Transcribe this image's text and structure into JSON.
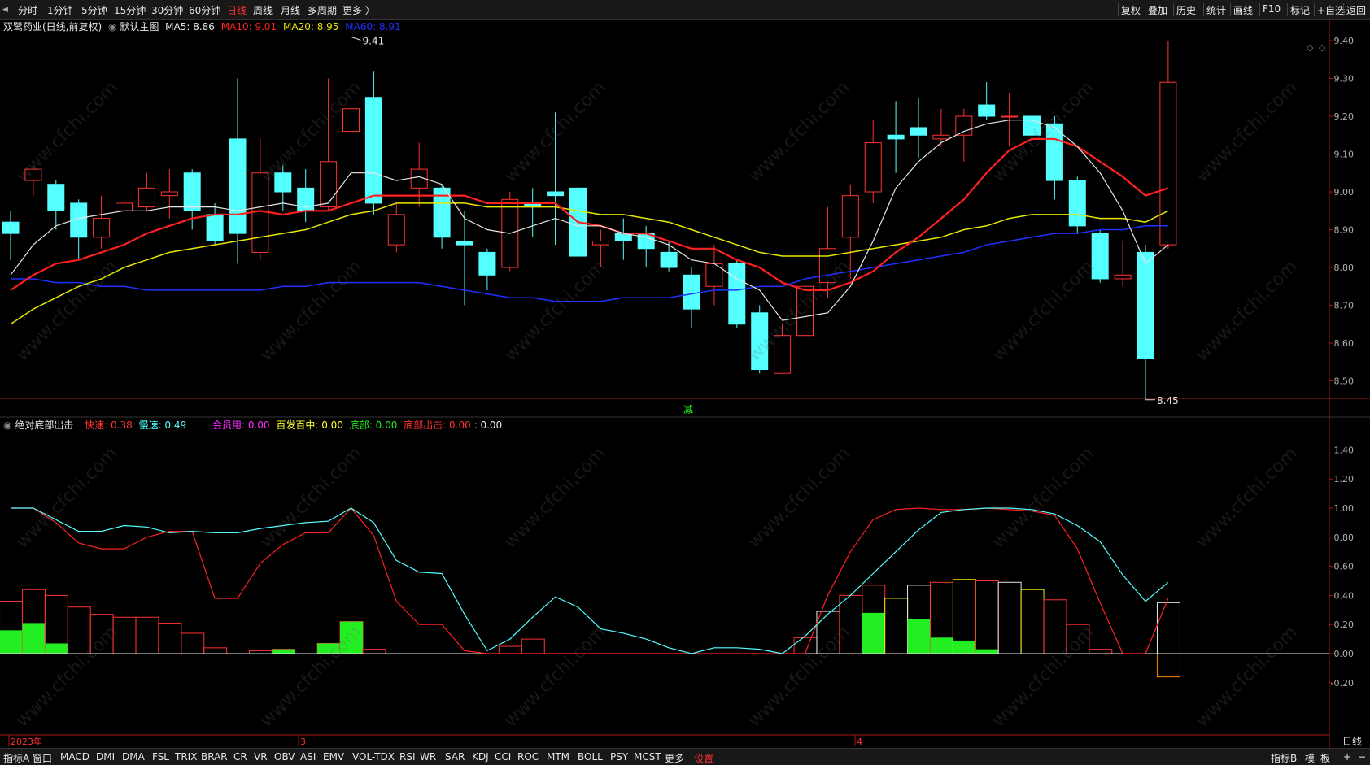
{
  "toolbar": {
    "left_items": [
      "分时",
      "1分钟",
      "5分钟",
      "15分钟",
      "30分钟",
      "60分钟",
      "日线",
      "周线",
      "月线",
      "多周期",
      "更多 〉"
    ],
    "active": "日线",
    "right_items": [
      "复权",
      "叠加",
      "历史",
      "统计",
      "画线",
      "F10",
      "标记",
      "+自选",
      "返回"
    ]
  },
  "main_info": {
    "title": "双鹭药业(日线,前复权)",
    "template_label": "默认主图",
    "ma5": "MA5: 8.86",
    "ma10": "MA10: 9.01",
    "ma20": "MA20: 8.95",
    "ma60": "MA60: 8.91"
  },
  "sub_info": {
    "name": "绝对底部出击",
    "fast": "快速: 0.38",
    "slow": "慢速: 0.49",
    "member": "会员用: 0.00",
    "baifa": "百发百中: 0.00",
    "bottom": "底部: 0.00",
    "bottom_strike": "底部出击: 0.00",
    "extra": ": 0.00"
  },
  "colors": {
    "up": "#ff3232",
    "down": "#54ffff",
    "ma5": "#e6e6e6",
    "ma10": "#ff2020",
    "ma20": "#e6e600",
    "ma60": "#2030ff",
    "grid_axis": "#b01515",
    "green": "#22ee22"
  },
  "date_labels": [
    "2023年",
    "3",
    "4"
  ],
  "marker_label": "减",
  "bottom_tabs": [
    "指标A",
    "窗口",
    "MACD",
    "DMI",
    "DMA",
    "FSL",
    "TRIX",
    "BRAR",
    "CR",
    "VR",
    "OBV",
    "ASI",
    "EMV",
    "VOL-TDX",
    "RSI",
    "WR",
    "SAR",
    "KDJ",
    "CCI",
    "ROC",
    "MTM",
    "BOLL",
    "PSY",
    "MCST",
    "更多",
    "设置"
  ],
  "bottom_right": [
    "指标B",
    "模",
    "板",
    "+",
    "−"
  ],
  "right_panel_label": "日线",
  "watermark": "www.cfchi.com",
  "chart_data": [
    {
      "type": "candlestick",
      "title": "双鹭药业(日线,前复权)",
      "ylim": [
        8.45,
        9.45
      ],
      "y_ticks": [
        9.4,
        9.3,
        9.2,
        9.1,
        9.0,
        8.9,
        8.8,
        8.7,
        8.6,
        8.5
      ],
      "high_label": "9.41",
      "low_label": "8.45",
      "candles": [
        [
          8.92,
          8.89,
          8.95,
          8.82
        ],
        [
          9.03,
          9.06,
          9.07,
          8.99
        ],
        [
          9.02,
          8.95,
          9.03,
          8.9
        ],
        [
          8.97,
          8.88,
          8.98,
          8.82
        ],
        [
          8.88,
          8.93,
          8.99,
          8.85
        ],
        [
          8.95,
          8.97,
          8.98,
          8.83
        ],
        [
          8.96,
          9.01,
          9.05,
          8.95
        ],
        [
          8.99,
          9.0,
          9.06,
          8.93
        ],
        [
          9.05,
          8.95,
          9.06,
          8.9
        ],
        [
          8.94,
          8.87,
          8.97,
          8.86
        ],
        [
          9.14,
          8.89,
          9.3,
          8.81
        ],
        [
          8.84,
          9.05,
          9.14,
          8.82
        ],
        [
          9.05,
          9.0,
          9.07,
          8.95
        ],
        [
          9.01,
          8.95,
          9.06,
          8.92
        ],
        [
          8.96,
          9.08,
          9.3,
          8.95
        ],
        [
          9.16,
          9.22,
          9.41,
          9.15
        ],
        [
          9.25,
          8.97,
          9.32,
          8.94
        ],
        [
          8.86,
          8.94,
          8.97,
          8.84
        ],
        [
          9.01,
          9.06,
          9.13,
          8.96
        ],
        [
          9.01,
          8.88,
          9.02,
          8.85
        ],
        [
          8.87,
          8.86,
          8.95,
          8.7
        ],
        [
          8.84,
          8.78,
          8.85,
          8.74
        ],
        [
          8.8,
          8.98,
          9.0,
          8.79
        ],
        [
          8.97,
          8.96,
          9.01,
          8.88
        ],
        [
          9.0,
          8.99,
          9.21,
          8.86
        ],
        [
          9.01,
          8.83,
          9.03,
          8.79
        ],
        [
          8.86,
          8.87,
          8.9,
          8.8
        ],
        [
          8.89,
          8.87,
          8.93,
          8.82
        ],
        [
          8.89,
          8.85,
          8.91,
          8.8
        ],
        [
          8.84,
          8.8,
          8.87,
          8.79
        ],
        [
          8.78,
          8.69,
          8.8,
          8.64
        ],
        [
          8.75,
          8.81,
          8.86,
          8.7
        ],
        [
          8.81,
          8.65,
          8.82,
          8.64
        ],
        [
          8.68,
          8.53,
          8.7,
          8.52
        ],
        [
          8.52,
          8.62,
          8.65,
          8.52
        ],
        [
          8.62,
          8.75,
          8.8,
          8.59
        ],
        [
          8.76,
          8.85,
          8.96,
          8.72
        ],
        [
          8.88,
          8.99,
          9.02,
          8.77
        ],
        [
          9.0,
          9.13,
          9.19,
          8.97
        ],
        [
          9.15,
          9.14,
          9.24,
          9.05
        ],
        [
          9.17,
          9.15,
          9.25,
          9.09
        ],
        [
          9.14,
          9.15,
          9.22,
          9.12
        ],
        [
          9.15,
          9.2,
          9.22,
          9.08
        ],
        [
          9.23,
          9.2,
          9.29,
          9.19
        ],
        [
          9.2,
          9.2,
          9.26,
          9.12
        ],
        [
          9.2,
          9.15,
          9.21,
          9.1
        ],
        [
          9.18,
          9.03,
          9.2,
          8.98
        ],
        [
          9.03,
          8.91,
          9.04,
          8.89
        ],
        [
          8.89,
          8.77,
          8.9,
          8.76
        ],
        [
          8.77,
          8.78,
          8.87,
          8.75
        ],
        [
          8.84,
          8.56,
          8.86,
          8.45
        ],
        [
          8.86,
          9.29,
          9.4,
          8.85
        ]
      ],
      "ma5": [
        8.78,
        8.86,
        8.91,
        8.93,
        8.94,
        8.95,
        8.95,
        8.96,
        8.96,
        8.96,
        8.95,
        8.96,
        8.97,
        8.96,
        8.97,
        9.05,
        9.05,
        9.03,
        9.04,
        9.02,
        8.93,
        8.9,
        8.89,
        8.91,
        8.93,
        8.91,
        8.91,
        8.89,
        8.88,
        8.86,
        8.82,
        8.81,
        8.77,
        8.74,
        8.66,
        8.67,
        8.68,
        8.75,
        8.87,
        9.01,
        9.08,
        9.13,
        9.16,
        9.18,
        9.19,
        9.19,
        9.17,
        9.12,
        9.05,
        8.95,
        8.81,
        8.86
      ],
      "ma10": [
        8.74,
        8.78,
        8.81,
        8.82,
        8.84,
        8.86,
        8.89,
        8.91,
        8.93,
        8.94,
        8.94,
        8.95,
        8.94,
        8.95,
        8.95,
        8.97,
        8.99,
        8.99,
        8.99,
        8.99,
        8.99,
        8.97,
        8.97,
        8.97,
        8.97,
        8.92,
        8.91,
        8.89,
        8.89,
        8.87,
        8.85,
        8.85,
        8.82,
        8.8,
        8.76,
        8.74,
        8.74,
        8.76,
        8.79,
        8.84,
        8.88,
        8.93,
        8.98,
        9.05,
        9.11,
        9.14,
        9.14,
        9.12,
        9.08,
        9.04,
        8.99,
        9.01
      ],
      "ma20": [
        8.65,
        8.69,
        8.72,
        8.75,
        8.77,
        8.8,
        8.82,
        8.84,
        8.85,
        8.86,
        8.87,
        8.88,
        8.89,
        8.9,
        8.92,
        8.94,
        8.95,
        8.97,
        8.97,
        8.97,
        8.97,
        8.96,
        8.96,
        8.96,
        8.96,
        8.95,
        8.94,
        8.94,
        8.93,
        8.92,
        8.9,
        8.88,
        8.86,
        8.84,
        8.83,
        8.83,
        8.83,
        8.84,
        8.85,
        8.86,
        8.87,
        8.88,
        8.9,
        8.91,
        8.93,
        8.94,
        8.94,
        8.94,
        8.93,
        8.93,
        8.92,
        8.95
      ],
      "ma60": [
        8.77,
        8.77,
        8.76,
        8.76,
        8.75,
        8.75,
        8.74,
        8.74,
        8.74,
        8.74,
        8.74,
        8.74,
        8.75,
        8.75,
        8.76,
        8.76,
        8.76,
        8.76,
        8.76,
        8.75,
        8.74,
        8.73,
        8.72,
        8.72,
        8.71,
        8.71,
        8.71,
        8.72,
        8.72,
        8.72,
        8.73,
        8.74,
        8.74,
        8.75,
        8.75,
        8.77,
        8.78,
        8.79,
        8.8,
        8.81,
        8.82,
        8.83,
        8.84,
        8.86,
        8.87,
        8.88,
        8.89,
        8.89,
        8.9,
        8.9,
        8.91,
        8.91
      ]
    },
    {
      "type": "line",
      "title": "绝对底部出击",
      "ylim": [
        -0.32,
        1.5
      ],
      "y_ticks": [
        1.4,
        1.2,
        1.0,
        0.8,
        0.6,
        0.4,
        0.2,
        0.0,
        -0.2
      ],
      "series": [
        {
          "name": "快速",
          "values": [
            1.0,
            1.0,
            0.9,
            0.76,
            0.72,
            0.72,
            0.8,
            0.84,
            0.84,
            0.38,
            0.38,
            0.62,
            0.75,
            0.83,
            0.83,
            1.0,
            0.81,
            0.36,
            0.2,
            0.2,
            0.02,
            0.0,
            0.0,
            0.0,
            0.0,
            0.0,
            0.0,
            0.0,
            0.0,
            0.0,
            0.0,
            0.0,
            0.0,
            0.0,
            0.0,
            0.0,
            0.4,
            0.7,
            0.92,
            0.99,
            1.0,
            0.99,
            0.99,
            1.0,
            0.99,
            0.98,
            0.95,
            0.72,
            0.35,
            0.0,
            0.0,
            0.38
          ]
        },
        {
          "name": "慢速",
          "values": [
            1.0,
            1.0,
            0.92,
            0.84,
            0.84,
            0.88,
            0.87,
            0.83,
            0.84,
            0.83,
            0.83,
            0.86,
            0.88,
            0.9,
            0.91,
            1.0,
            0.9,
            0.64,
            0.56,
            0.55,
            0.27,
            0.02,
            0.1,
            0.25,
            0.39,
            0.32,
            0.17,
            0.14,
            0.1,
            0.04,
            0.0,
            0.04,
            0.04,
            0.03,
            0.0,
            0.12,
            0.27,
            0.4,
            0.55,
            0.7,
            0.85,
            0.97,
            0.99,
            1.0,
            1.0,
            0.99,
            0.96,
            0.88,
            0.77,
            0.54,
            0.36,
            0.49
          ]
        }
      ],
      "bars": [
        [
          0.36,
          0.16
        ],
        [
          0.44,
          0.21
        ],
        [
          0.4,
          0.07
        ],
        [
          0.32,
          0.0
        ],
        [
          0.27,
          0.0
        ],
        [
          0.25,
          0.0
        ],
        [
          0.25,
          0.0
        ],
        [
          0.21,
          0.0
        ],
        [
          0.14,
          0.0
        ],
        [
          0.04,
          0.0
        ],
        [
          0.0,
          0.0
        ],
        [
          0.02,
          0.0
        ],
        [
          0.03,
          0.03
        ],
        [
          0.0,
          0.0
        ],
        [
          0.07,
          0.07
        ],
        [
          0.22,
          0.22
        ],
        [
          0.03,
          0.0
        ],
        [
          0.0,
          0.0
        ],
        [
          0.0,
          0.0
        ],
        [
          0.0,
          0.0
        ],
        [
          0.0,
          0.0
        ],
        [
          0.0,
          0.0
        ],
        [
          0.05,
          0.0
        ],
        [
          0.1,
          0.0
        ],
        [
          0.0,
          0.0
        ],
        [
          0.0,
          0.0
        ],
        [
          0.0,
          0.0
        ],
        [
          0.0,
          0.0
        ],
        [
          0.0,
          0.0
        ],
        [
          0.0,
          0.0
        ],
        [
          0.0,
          0.0
        ],
        [
          0.0,
          0.0
        ],
        [
          0.0,
          0.0
        ],
        [
          0.0,
          0.0
        ],
        [
          0.0,
          0.0
        ],
        [
          0.11,
          0.0
        ],
        [
          0.29,
          0.0
        ],
        [
          0.4,
          0.0
        ],
        [
          0.47,
          0.28
        ],
        [
          0.38,
          0.0
        ],
        [
          0.47,
          0.24
        ],
        [
          0.49,
          0.11
        ],
        [
          0.51,
          0.09
        ],
        [
          0.5,
          0.03
        ],
        [
          0.49,
          0.0
        ],
        [
          0.44,
          0.0
        ],
        [
          0.37,
          0.0
        ],
        [
          0.2,
          0.0
        ],
        [
          0.03,
          0.0
        ],
        [
          0.0,
          0.0
        ],
        [
          0.0,
          0.0
        ],
        [
          0.35,
          -0.16
        ]
      ]
    }
  ]
}
